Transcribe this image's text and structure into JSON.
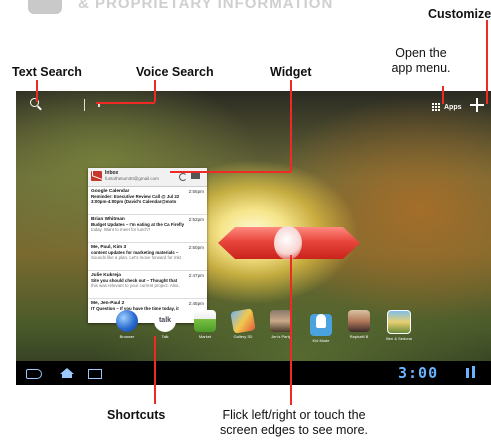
{
  "header": {
    "text": "& PROPRIETARY INFORMATION"
  },
  "callouts": {
    "customize": "Customize",
    "open_menu_line1": "Open the",
    "open_menu_line2": "app menu.",
    "text_search": "Text Search",
    "voice_search": "Voice Search",
    "widget": "Widget",
    "shortcuts": "Shortcuts",
    "flick_line1": "Flick left/right or touch the",
    "flick_line2": "screen edges to see more."
  },
  "screen": {
    "apps_label": "Apps",
    "widget": {
      "title": "Inbox",
      "account": "funtothetum30@gmail.com",
      "messages": [
        {
          "from": "Google Calendar",
          "time": "2:55pm",
          "lines": [
            "Reminder: Executive Review Call @ Jul 22",
            "3:00pm-4:00pm (David's Calendar@moto"
          ],
          "style": [
            "bold",
            "bold"
          ]
        },
        {
          "from": "Brian Whitman",
          "time": "2:52pm",
          "lines": [
            "Budget Updates – I'm eating at the Ca Firefly",
            "today.  Want to meet for lunch?"
          ],
          "style": [
            "bold",
            "faint"
          ]
        },
        {
          "from": "Me, Paul, Kim  3",
          "time": "2:50pm",
          "lines": [
            "content updates for marketing materials –",
            "Sounds like a plan. Let's move forward for mkt"
          ],
          "style": [
            "bold",
            "faint"
          ]
        },
        {
          "from": "Julie Kukreja",
          "time": "2:47pm",
          "lines": [
            "Site you should check out – Thought that",
            "this was relevant to your current project. Also,"
          ],
          "style": [
            "bold",
            "faint"
          ]
        },
        {
          "from": "Me, Jen-Paul  2",
          "time": "2:45pm",
          "lines": [
            "IT Question – If you have the time today, it",
            ""
          ],
          "style": [
            "bold",
            "faint"
          ]
        }
      ]
    },
    "shortcuts": [
      {
        "label": "Browser",
        "icon": "browser-icon"
      },
      {
        "label": "Talk",
        "icon": "talk-icon",
        "glyph": "talk"
      },
      {
        "label": "Market",
        "icon": "market-icon"
      },
      {
        "label": "Gallery 3D",
        "icon": "gallery-icon"
      },
      {
        "label": "Jen's Party",
        "icon": "photo-icon"
      },
      {
        "label": "Kid Mode",
        "icon": "kids-icon"
      },
      {
        "label": "Raphaël B",
        "icon": "photo2-icon"
      },
      {
        "label": "Ben & Sedona",
        "icon": "photo3-icon"
      }
    ],
    "clock": "3:00"
  },
  "colors": {
    "accent_line": "#ee2a24",
    "system_blue": "#6ab4ff"
  }
}
